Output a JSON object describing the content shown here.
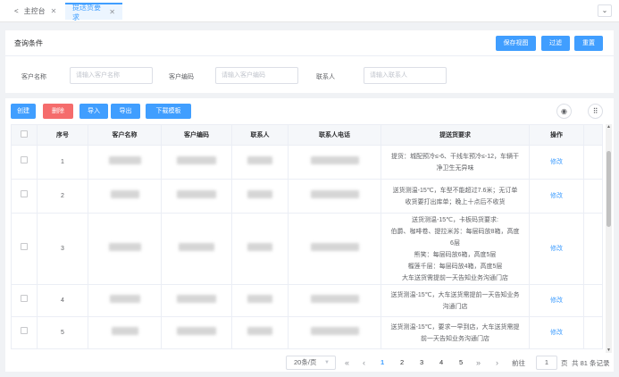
{
  "tabs": [
    {
      "label": "主控台"
    },
    {
      "label": "提送货要求"
    }
  ],
  "query": {
    "title": "查询条件",
    "buttons": {
      "save_view": "保存视图",
      "filter": "过滤",
      "reset": "重置"
    },
    "fields": [
      {
        "label": "客户名称",
        "placeholder": "请输入客户名称"
      },
      {
        "label": "客户编码",
        "placeholder": "请输入客户编码"
      },
      {
        "label": "联系人",
        "placeholder": "请输入联系人"
      }
    ]
  },
  "toolbar": {
    "create": "创建",
    "delete": "删除",
    "import": "导入",
    "export": "导出",
    "template": "下载模板"
  },
  "table": {
    "headers": [
      "序号",
      "客户名称",
      "客户编码",
      "联系人",
      "联系人电话",
      "提送货要求",
      "操作"
    ],
    "rows": [
      {
        "no": "1",
        "req_lines": [
          "提货：城配预冷≤-6、干线车预冷≤-12，车辆干净卫生无异味"
        ],
        "action": "修改"
      },
      {
        "no": "2",
        "req_lines": [
          "送货测温-15℃，车型不能超过7.6米；无订单收货要打出库单；晚上十点后不收货"
        ],
        "action": "修改"
      },
      {
        "no": "3",
        "req_lines": [
          "送货测温-15℃，卡板码货要求:",
          "伯爵、咖啡卷、提拉米苏：每层码放8箱，高度6层",
          "熊笑：每层码放6箱，高度5层",
          "榴莲千层：每层码放4箱，高度5层",
          "大车送货需提前一天告知业务沟通门店"
        ],
        "action": "修改"
      },
      {
        "no": "4",
        "req_lines": [
          "送货测温-15℃，大车送货需提前一天告知业务沟通门店"
        ],
        "action": "修改"
      },
      {
        "no": "5",
        "req_lines": [
          "送货测温-15℃，要求一早到店，大车送货需提前一天告知业务沟通门店"
        ],
        "action": "修改"
      }
    ]
  },
  "pagination": {
    "page_size": "20条/页",
    "pages": [
      "1",
      "2",
      "3",
      "4",
      "5"
    ],
    "current": "1",
    "goto_label": "前往",
    "goto_value": "1",
    "page_unit": "页",
    "total": "共 81 条记录"
  },
  "colors": {
    "primary": "#409eff",
    "danger": "#f56c6c"
  },
  "icons": [
    "share-icon",
    "close-icon",
    "chevron-down-icon",
    "eye-icon",
    "grid-icon",
    "double-left-icon",
    "left-icon",
    "right-icon",
    "double-right-icon"
  ]
}
